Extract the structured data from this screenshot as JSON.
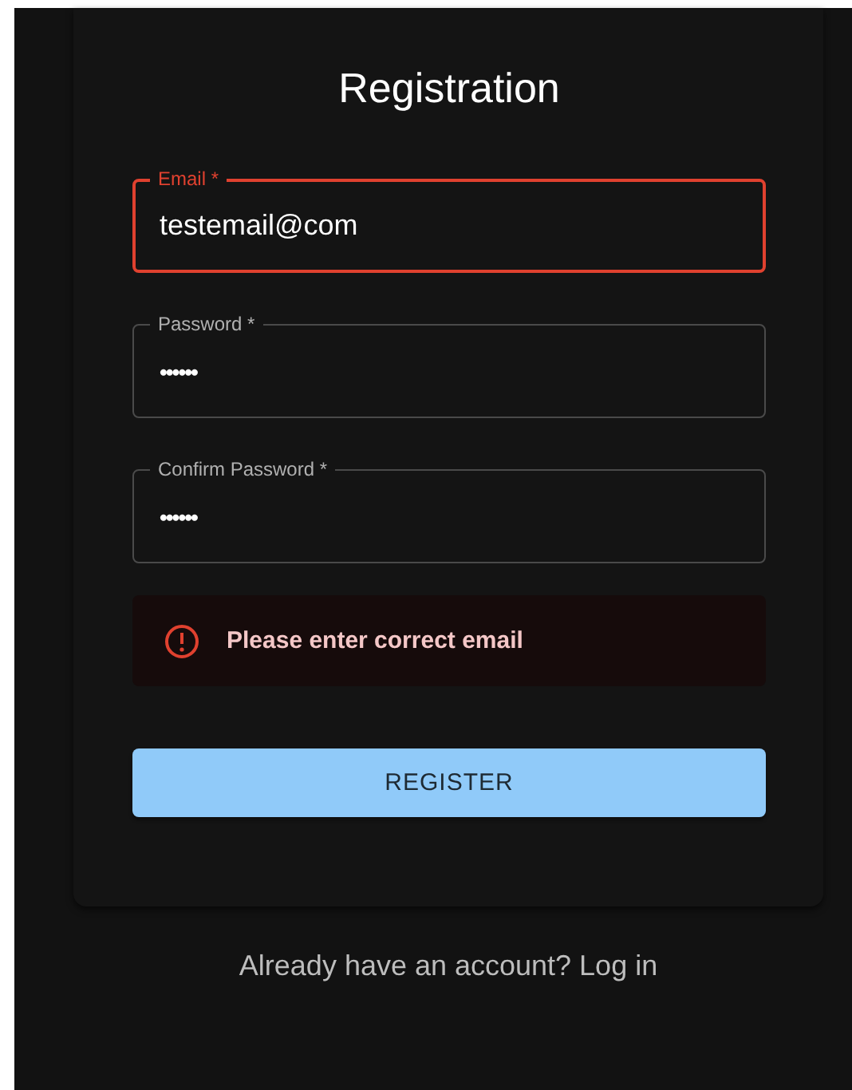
{
  "title": "Registration",
  "fields": [
    {
      "label": "Email *",
      "value": "testemail@com",
      "kind": "text",
      "error": true
    },
    {
      "label": "Password *",
      "value": "••••••",
      "kind": "password",
      "error": false
    },
    {
      "label": "Confirm Password *",
      "value": "••••••",
      "kind": "password",
      "error": false
    }
  ],
  "alert": {
    "kind": "error",
    "message": "Please enter correct email"
  },
  "button": {
    "label": "REGISTER"
  },
  "footer": {
    "text": "Already have an account? Log in"
  }
}
